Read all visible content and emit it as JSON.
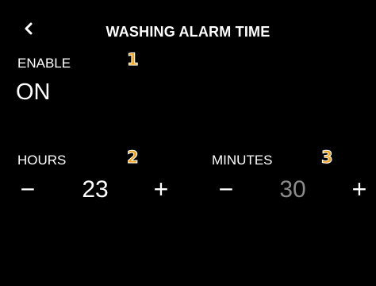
{
  "header": {
    "title": "WASHING ALARM TIME",
    "back_icon": "chevron-left-icon"
  },
  "enable": {
    "label": "ENABLE",
    "value": "ON",
    "callout": "1"
  },
  "hours": {
    "label": "HOURS",
    "value": "23",
    "decrement": "−",
    "increment": "+",
    "callout": "2"
  },
  "minutes": {
    "label": "MINUTES",
    "value": "30",
    "decrement": "−",
    "increment": "+",
    "callout": "3"
  },
  "colors": {
    "background": "#000000",
    "text": "#ffffff",
    "muted_value": "#8a8a8a",
    "callout": "#f3a21a"
  }
}
